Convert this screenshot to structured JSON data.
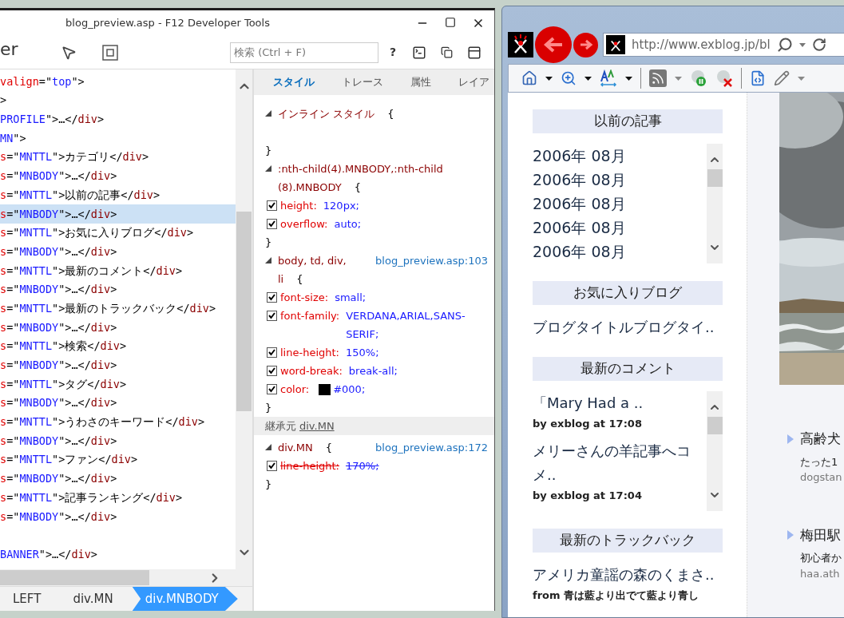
{
  "devtools": {
    "title": "blog_preview.asp - F12 Developer Tools",
    "tool_name": "er",
    "search": {
      "placeholder": "検索 (Ctrl + F)"
    },
    "help": "?",
    "dom_lines": [
      {
        "kind": "node",
        "selected": false,
        "segments": [
          {
            "kind": "attr",
            "text": "valign"
          },
          {
            "kind": "punct",
            "text": "=\""
          },
          {
            "kind": "value",
            "text": "top"
          },
          {
            "kind": "punct",
            "text": "\">"
          }
        ]
      },
      {
        "kind": "node",
        "selected": false,
        "segments": [
          {
            "kind": "punct",
            "text": ">"
          }
        ]
      },
      {
        "kind": "node",
        "selected": false,
        "segments": [
          {
            "kind": "value",
            "text": "PROFILE"
          },
          {
            "kind": "punct",
            "text": "\">…</"
          },
          {
            "kind": "tag",
            "text": "div"
          },
          {
            "kind": "punct",
            "text": ">"
          }
        ]
      },
      {
        "kind": "node",
        "selected": false,
        "segments": [
          {
            "kind": "value",
            "text": "MN"
          },
          {
            "kind": "punct",
            "text": "\">"
          }
        ]
      },
      {
        "kind": "node",
        "selected": false,
        "segments": [
          {
            "kind": "attr",
            "text": "s"
          },
          {
            "kind": "punct",
            "text": "=\""
          },
          {
            "kind": "value",
            "text": "MNTTL"
          },
          {
            "kind": "punct",
            "text": "\">カテゴリ</"
          },
          {
            "kind": "tag",
            "text": "div"
          },
          {
            "kind": "punct",
            "text": ">"
          }
        ]
      },
      {
        "kind": "node",
        "selected": false,
        "segments": [
          {
            "kind": "attr",
            "text": "s"
          },
          {
            "kind": "punct",
            "text": "=\""
          },
          {
            "kind": "value",
            "text": "MNBODY"
          },
          {
            "kind": "punct",
            "text": "\">…</"
          },
          {
            "kind": "tag",
            "text": "div"
          },
          {
            "kind": "punct",
            "text": ">"
          }
        ]
      },
      {
        "kind": "node",
        "selected": false,
        "segments": [
          {
            "kind": "attr",
            "text": "s"
          },
          {
            "kind": "punct",
            "text": "=\""
          },
          {
            "kind": "value",
            "text": "MNTTL"
          },
          {
            "kind": "punct",
            "text": "\">以前の記事</"
          },
          {
            "kind": "tag",
            "text": "div"
          },
          {
            "kind": "punct",
            "text": ">"
          }
        ]
      },
      {
        "kind": "node",
        "selected": true,
        "segments": [
          {
            "kind": "attr",
            "text": "s"
          },
          {
            "kind": "punct",
            "text": "=\""
          },
          {
            "kind": "value",
            "text": "MNBODY"
          },
          {
            "kind": "punct",
            "text": "\">…</"
          },
          {
            "kind": "tag",
            "text": "div"
          },
          {
            "kind": "punct",
            "text": ">"
          }
        ]
      },
      {
        "kind": "node",
        "selected": false,
        "segments": [
          {
            "kind": "attr",
            "text": "s"
          },
          {
            "kind": "punct",
            "text": "=\""
          },
          {
            "kind": "value",
            "text": "MNTTL"
          },
          {
            "kind": "punct",
            "text": "\">お気に入りブログ</"
          },
          {
            "kind": "tag",
            "text": "div"
          },
          {
            "kind": "punct",
            "text": ">"
          }
        ]
      },
      {
        "kind": "node",
        "selected": false,
        "segments": [
          {
            "kind": "attr",
            "text": "s"
          },
          {
            "kind": "punct",
            "text": "=\""
          },
          {
            "kind": "value",
            "text": "MNBODY"
          },
          {
            "kind": "punct",
            "text": "\">…</"
          },
          {
            "kind": "tag",
            "text": "div"
          },
          {
            "kind": "punct",
            "text": ">"
          }
        ]
      },
      {
        "kind": "node",
        "selected": false,
        "segments": [
          {
            "kind": "attr",
            "text": "s"
          },
          {
            "kind": "punct",
            "text": "=\""
          },
          {
            "kind": "value",
            "text": "MNTTL"
          },
          {
            "kind": "punct",
            "text": "\">最新のコメント</"
          },
          {
            "kind": "tag",
            "text": "div"
          },
          {
            "kind": "punct",
            "text": ">"
          }
        ]
      },
      {
        "kind": "node",
        "selected": false,
        "segments": [
          {
            "kind": "attr",
            "text": "s"
          },
          {
            "kind": "punct",
            "text": "=\""
          },
          {
            "kind": "value",
            "text": "MNBODY"
          },
          {
            "kind": "punct",
            "text": "\">…</"
          },
          {
            "kind": "tag",
            "text": "div"
          },
          {
            "kind": "punct",
            "text": ">"
          }
        ]
      },
      {
        "kind": "node",
        "selected": false,
        "segments": [
          {
            "kind": "attr",
            "text": "s"
          },
          {
            "kind": "punct",
            "text": "=\""
          },
          {
            "kind": "value",
            "text": "MNTTL"
          },
          {
            "kind": "punct",
            "text": "\">最新のトラックバック</"
          },
          {
            "kind": "tag",
            "text": "div"
          },
          {
            "kind": "punct",
            "text": ">"
          }
        ]
      },
      {
        "kind": "node",
        "selected": false,
        "segments": [
          {
            "kind": "attr",
            "text": "s"
          },
          {
            "kind": "punct",
            "text": "=\""
          },
          {
            "kind": "value",
            "text": "MNBODY"
          },
          {
            "kind": "punct",
            "text": "\">…</"
          },
          {
            "kind": "tag",
            "text": "div"
          },
          {
            "kind": "punct",
            "text": ">"
          }
        ]
      },
      {
        "kind": "node",
        "selected": false,
        "segments": [
          {
            "kind": "attr",
            "text": "s"
          },
          {
            "kind": "punct",
            "text": "=\""
          },
          {
            "kind": "value",
            "text": "MNTTL"
          },
          {
            "kind": "punct",
            "text": "\">検索</"
          },
          {
            "kind": "tag",
            "text": "div"
          },
          {
            "kind": "punct",
            "text": ">"
          }
        ]
      },
      {
        "kind": "node",
        "selected": false,
        "segments": [
          {
            "kind": "attr",
            "text": "s"
          },
          {
            "kind": "punct",
            "text": "=\""
          },
          {
            "kind": "value",
            "text": "MNBODY"
          },
          {
            "kind": "punct",
            "text": "\">…</"
          },
          {
            "kind": "tag",
            "text": "div"
          },
          {
            "kind": "punct",
            "text": ">"
          }
        ]
      },
      {
        "kind": "node",
        "selected": false,
        "segments": [
          {
            "kind": "attr",
            "text": "s"
          },
          {
            "kind": "punct",
            "text": "=\""
          },
          {
            "kind": "value",
            "text": "MNTTL"
          },
          {
            "kind": "punct",
            "text": "\">タグ</"
          },
          {
            "kind": "tag",
            "text": "div"
          },
          {
            "kind": "punct",
            "text": ">"
          }
        ]
      },
      {
        "kind": "node",
        "selected": false,
        "segments": [
          {
            "kind": "attr",
            "text": "s"
          },
          {
            "kind": "punct",
            "text": "=\""
          },
          {
            "kind": "value",
            "text": "MNBODY"
          },
          {
            "kind": "punct",
            "text": "\">…</"
          },
          {
            "kind": "tag",
            "text": "div"
          },
          {
            "kind": "punct",
            "text": ">"
          }
        ]
      },
      {
        "kind": "node",
        "selected": false,
        "segments": [
          {
            "kind": "attr",
            "text": "s"
          },
          {
            "kind": "punct",
            "text": "=\""
          },
          {
            "kind": "value",
            "text": "MNTTL"
          },
          {
            "kind": "punct",
            "text": "\">うわさのキーワード</"
          },
          {
            "kind": "tag",
            "text": "div"
          },
          {
            "kind": "punct",
            "text": ">"
          }
        ]
      },
      {
        "kind": "node",
        "selected": false,
        "segments": [
          {
            "kind": "attr",
            "text": "s"
          },
          {
            "kind": "punct",
            "text": "=\""
          },
          {
            "kind": "value",
            "text": "MNBODY"
          },
          {
            "kind": "punct",
            "text": "\">…</"
          },
          {
            "kind": "tag",
            "text": "div"
          },
          {
            "kind": "punct",
            "text": ">"
          }
        ]
      },
      {
        "kind": "node",
        "selected": false,
        "segments": [
          {
            "kind": "attr",
            "text": "s"
          },
          {
            "kind": "punct",
            "text": "=\""
          },
          {
            "kind": "value",
            "text": "MNTTL"
          },
          {
            "kind": "punct",
            "text": "\">ファン</"
          },
          {
            "kind": "tag",
            "text": "div"
          },
          {
            "kind": "punct",
            "text": ">"
          }
        ]
      },
      {
        "kind": "node",
        "selected": false,
        "segments": [
          {
            "kind": "attr",
            "text": "s"
          },
          {
            "kind": "punct",
            "text": "=\""
          },
          {
            "kind": "value",
            "text": "MNBODY"
          },
          {
            "kind": "punct",
            "text": "\">…</"
          },
          {
            "kind": "tag",
            "text": "div"
          },
          {
            "kind": "punct",
            "text": ">"
          }
        ]
      },
      {
        "kind": "node",
        "selected": false,
        "segments": [
          {
            "kind": "attr",
            "text": "s"
          },
          {
            "kind": "punct",
            "text": "=\""
          },
          {
            "kind": "value",
            "text": "MNTTL"
          },
          {
            "kind": "punct",
            "text": "\">記事ランキング</"
          },
          {
            "kind": "tag",
            "text": "div"
          },
          {
            "kind": "punct",
            "text": ">"
          }
        ]
      },
      {
        "kind": "node",
        "selected": false,
        "segments": [
          {
            "kind": "attr",
            "text": "s"
          },
          {
            "kind": "punct",
            "text": "=\""
          },
          {
            "kind": "value",
            "text": "MNBODY"
          },
          {
            "kind": "punct",
            "text": "\">…</"
          },
          {
            "kind": "tag",
            "text": "div"
          },
          {
            "kind": "punct",
            "text": ">"
          }
        ]
      },
      {
        "kind": "blank"
      },
      {
        "kind": "node",
        "selected": false,
        "segments": [
          {
            "kind": "value",
            "text": "BANNER"
          },
          {
            "kind": "punct",
            "text": "\">…</"
          },
          {
            "kind": "tag",
            "text": "div"
          },
          {
            "kind": "punct",
            "text": ">"
          }
        ]
      }
    ],
    "breadcrumbs": [
      {
        "label": "LEFT",
        "selected": false
      },
      {
        "label": "div.MN",
        "selected": false
      },
      {
        "label": "div.MNBODY",
        "selected": true
      }
    ],
    "tabs": [
      {
        "label": "スタイル",
        "selected": true
      },
      {
        "label": "トレース",
        "selected": false
      },
      {
        "label": "属性",
        "selected": false
      },
      {
        "label": "レイア",
        "selected": false
      }
    ],
    "rules": [
      {
        "selector": "インライン スタイル",
        "brace": "{",
        "empty_body": true,
        "close": "}"
      },
      {
        "selector": ":nth-child(4).MNBODY,:nth-child (8).MNBODY",
        "brace": "{",
        "empty_body": false,
        "close": "}",
        "properties": [
          {
            "name": "height:",
            "value": "120px;",
            "checked": true,
            "overridden": false
          },
          {
            "name": "overflow:",
            "value": "auto;",
            "checked": true,
            "overridden": false
          }
        ]
      },
      {
        "selector": "body, td, div, li",
        "brace": "{",
        "source": "blog_preview.asp:103",
        "empty_body": false,
        "close": "}",
        "properties": [
          {
            "name": "font-size:",
            "value": "small;",
            "checked": true,
            "overridden": false
          },
          {
            "name": "font-family:",
            "value": "VERDANA,ARIAL,SANS-SERIF;",
            "checked": true,
            "overridden": false
          },
          {
            "name": "line-height:",
            "value": "150%;",
            "checked": true,
            "overridden": false
          },
          {
            "name": "word-break:",
            "value": "break-all;",
            "checked": true,
            "overridden": false
          },
          {
            "name": "color:",
            "value": "#000;",
            "checked": true,
            "overridden": false,
            "color": "#000000"
          }
        ]
      },
      {
        "inherited_label": "継承元",
        "inherited_link": "div.MN",
        "selector": "div.MN",
        "brace": "{",
        "source": "blog_preview.asp:172",
        "empty_body": false,
        "close": "}",
        "properties": [
          {
            "name": "line-height:",
            "value": "170%;",
            "checked": true,
            "overridden": true
          }
        ]
      }
    ]
  },
  "browser": {
    "url": "http://www.exblog.jp/bl",
    "widgets": [
      {
        "title": "以前の記事",
        "kind": "scroll",
        "items": [
          {
            "kind": "archive",
            "text": "2006年 08月"
          },
          {
            "kind": "archive",
            "text": "2006年 08月"
          },
          {
            "kind": "archive",
            "text": "2006年 08月"
          },
          {
            "kind": "archive",
            "text": "2006年 08月"
          },
          {
            "kind": "archive",
            "text": "2006年 08月"
          }
        ]
      },
      {
        "title": "お気に入りブログ",
        "kind": "plain",
        "items": [
          {
            "kind": "link",
            "text": "ブログタイトルブログタイ.."
          }
        ]
      },
      {
        "title": "最新のコメント",
        "kind": "scroll",
        "items": [
          {
            "kind": "link",
            "text": "「Mary Had a .."
          },
          {
            "kind": "meta",
            "text": "by exblog at 17:08"
          },
          {
            "kind": "link",
            "text": "メリーさんの羊記事へコメ.."
          },
          {
            "kind": "meta",
            "text": "by exblog at 17:04"
          }
        ]
      },
      {
        "title": "最新のトラックバック",
        "kind": "plain",
        "items": [
          {
            "kind": "link",
            "text": "アメリカ童謡の森のくまさ.."
          },
          {
            "kind": "meta",
            "text": "from 青は藍より出でて藍より青し"
          }
        ]
      }
    ],
    "entries": [
      {
        "title": "高齢犬",
        "excerpt": "たった1",
        "source": "dogstan"
      },
      {
        "title": "梅田駅",
        "excerpt": "初心者か",
        "source": "haa.ath"
      }
    ]
  }
}
